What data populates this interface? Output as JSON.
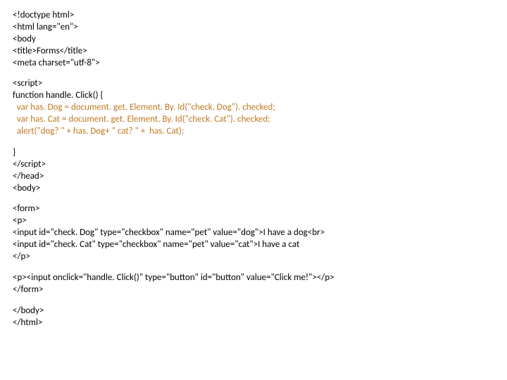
{
  "lines": [
    {
      "cls": "blk",
      "t": "<!doctype html>"
    },
    {
      "cls": "blk",
      "t": "<html lang=\"en\">"
    },
    {
      "cls": "blk",
      "t": "<body"
    },
    {
      "cls": "blk",
      "t": "<title>Forms</title>"
    },
    {
      "cls": "blk",
      "t": "<meta charset=\"utf-8\">"
    },
    {
      "cls": "blank",
      "t": ""
    },
    {
      "cls": "blk",
      "t": "<script>"
    },
    {
      "cls": "blk",
      "t": "function handle. Click() {"
    },
    {
      "cls": "orn",
      "t": "  var has. Dog = document. get. Element. By. Id(\"check. Dog\"). checked;"
    },
    {
      "cls": "orn",
      "t": "  var has. Cat = document. get. Element. By. Id(\"check. Cat\"). checked;"
    },
    {
      "cls": "orn",
      "t": "  alert(\"dog? \" + has. Dog+ \" cat? \" +  has. Cat);"
    },
    {
      "cls": "blank",
      "t": ""
    },
    {
      "cls": "blk",
      "t": "}"
    },
    {
      "cls": "blk",
      "t": "</script>"
    },
    {
      "cls": "blk",
      "t": "</head>"
    },
    {
      "cls": "blk",
      "t": "<body>"
    },
    {
      "cls": "blank",
      "t": ""
    },
    {
      "cls": "blk",
      "t": "<form>"
    },
    {
      "cls": "blk",
      "t": "<p>"
    },
    {
      "cls": "blk",
      "t": "<input id=\"check. Dog\" type=\"checkbox\" name=\"pet\" value=\"dog\">I have a dog<br>"
    },
    {
      "cls": "blk",
      "t": "<input id=\"check. Cat\" type=\"checkbox\" name=\"pet\" value=\"cat\">I have a cat"
    },
    {
      "cls": "blk",
      "t": "</p>"
    },
    {
      "cls": "blank",
      "t": ""
    },
    {
      "cls": "blk",
      "t": "<p><input onclick=\"handle. Click()\" type=\"button\" id=\"button\" value=\"Click me!\"></p>"
    },
    {
      "cls": "blk",
      "t": "</form>"
    },
    {
      "cls": "blank",
      "t": ""
    },
    {
      "cls": "blk",
      "t": "</body>"
    },
    {
      "cls": "blk",
      "t": "</html>"
    }
  ]
}
